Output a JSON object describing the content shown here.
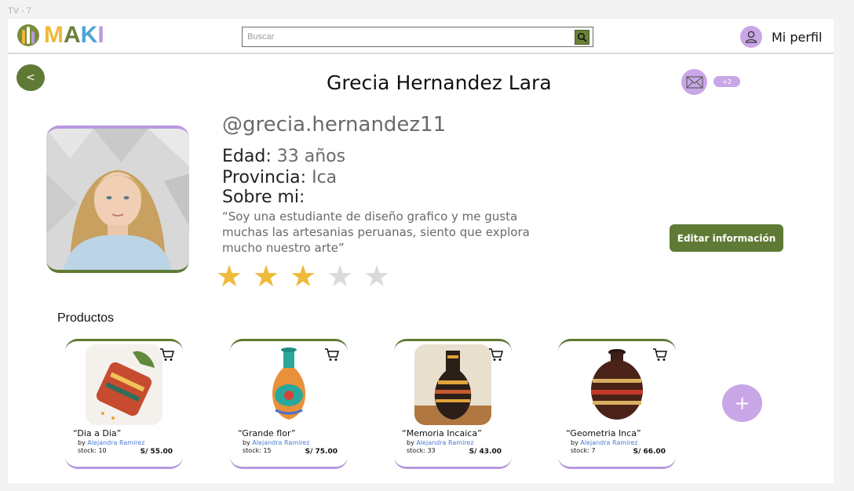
{
  "frame_label": "TV - 7",
  "header": {
    "logo_text": "MAKI",
    "search_placeholder": "Buscar",
    "profile_label": "Mi perfil"
  },
  "profile": {
    "back_label": "<",
    "name": "Grecia Hernandez Lara",
    "notification_badge": "+2",
    "handle": "@grecia.hernandez11",
    "age_key": "Edad",
    "age_value": "33 años",
    "province_key": "Provincia",
    "province_value": "Ica",
    "about_key": "Sobre mi",
    "about_text": "“Soy una estudiante de diseño grafico y me gusta muchas las artesanias peruanas, siento que explora mucho nuestro arte”",
    "edit_label": "Editar información",
    "rating": 3,
    "rating_max": 5
  },
  "products_section": {
    "title": "Productos",
    "add_label": "+"
  },
  "products": [
    {
      "name": "“Dia a Dia”",
      "by_label": "by",
      "author": "Alejandra Ramirez",
      "stock": "stock: 10",
      "price": "S/ 55.00"
    },
    {
      "name": "“Grande flor”",
      "by_label": "by",
      "author": "Alejandra Ramirez",
      "stock": "stock: 15",
      "price": "S/ 75.00"
    },
    {
      "name": "“Memoria Incaica”",
      "by_label": "by",
      "author": "Alejandra Ramirez",
      "stock": "stock: 33",
      "price": "S/ 43.00"
    },
    {
      "name": "“Geometria Inca”",
      "by_label": "by",
      "author": "Alejandra Ramirez",
      "stock": "stock: 7",
      "price": "S/ 66.00"
    }
  ],
  "colors": {
    "brand_green": "#5f7a34",
    "brand_purple": "#c9a6e6",
    "star_on": "#f0b93a",
    "star_off": "#dadada"
  }
}
